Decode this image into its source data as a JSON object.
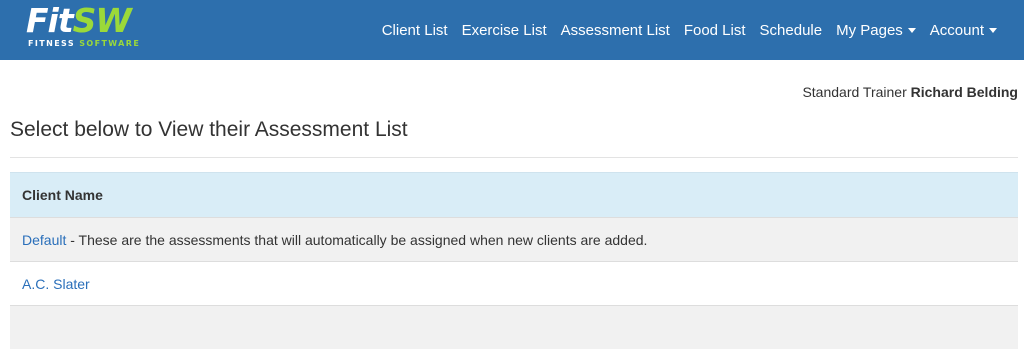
{
  "brand": {
    "name_main": "Fit",
    "name_accent": "SW",
    "tagline_main": "FITNESS",
    "tagline_accent": "SOFTWARE"
  },
  "nav": {
    "items": [
      {
        "label": "Client List"
      },
      {
        "label": "Exercise List"
      },
      {
        "label": "Assessment List"
      },
      {
        "label": "Food List"
      },
      {
        "label": "Schedule"
      },
      {
        "label": "My Pages"
      },
      {
        "label": "Account"
      }
    ]
  },
  "trainer": {
    "role": "Standard Trainer",
    "name": "Richard Belding"
  },
  "page": {
    "title": "Select below to View their Assessment List"
  },
  "table": {
    "header": "Client Name",
    "rows": [
      {
        "link": "Default",
        "description": " - These are the assessments that will automatically be assigned when new clients are added."
      },
      {
        "link": "A.C. Slater",
        "description": ""
      }
    ]
  },
  "colors": {
    "navbar": "#2d6fad",
    "brand_accent": "#9bd93a",
    "link": "#2a6fba",
    "table_header": "#d9edf7"
  }
}
